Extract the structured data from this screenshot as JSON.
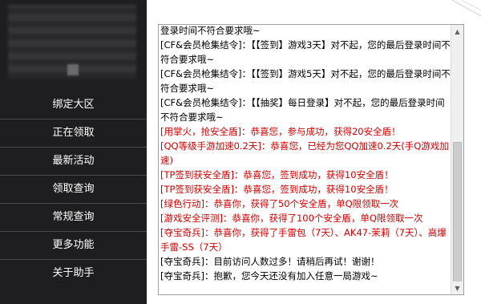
{
  "sidebar": {
    "items": [
      {
        "label": "绑定大区"
      },
      {
        "label": "正在领取"
      },
      {
        "label": "最新活动"
      },
      {
        "label": "领取查询"
      },
      {
        "label": "常规查询"
      },
      {
        "label": "更多功能"
      },
      {
        "label": "关于助手"
      }
    ]
  },
  "log": {
    "lines": [
      {
        "text": "登录时间不符合要求哦~",
        "color": "#000000"
      },
      {
        "text": "[CF&会员枪集结令]：【【签到】游戏3天】对不起，您的最后登录时间不符合要求哦~",
        "color": "#000000"
      },
      {
        "text": "[CF&会员枪集结令]：【【签到】游戏5天】对不起，您的最后登录时间不符合要求哦~",
        "color": "#000000"
      },
      {
        "text": "[CF&会员枪集结令]：【【抽奖】每日登录】对不起，您的最后登录时间不符合要求哦~",
        "color": "#000000"
      },
      {
        "text": "[用掌火，抢安全盾]：恭喜您，参与成功，获得20安全盾！",
        "color": "#d40000"
      },
      {
        "text": "[QQ等级手游加速0.2天]：恭喜您，已经为您QQ加速0.2天(手Q游戏加速)",
        "color": "#d40000"
      },
      {
        "text": "[TP签到获安全盾]：恭喜您，签到成功，获得10安全盾！",
        "color": "#d40000"
      },
      {
        "text": "[TP签到获安全盾]：恭喜您，签到成功，获得10安全盾！",
        "color": "#d40000"
      },
      {
        "text": "[绿色行动]：恭喜你，获得了50个安全盾，单Q限领取一次",
        "color": "#d40000"
      },
      {
        "text": "[游戏安全评测]：恭喜你，获得了100个安全盾，单Q限领取一次",
        "color": "#d40000"
      },
      {
        "text": "[夺宝奇兵]：恭喜你，获得了手雷包（7天）、AK47-茉莉（7天）、高爆手雷-SS（7天）",
        "color": "#d40000"
      },
      {
        "text": "[夺宝奇兵]：目前访问人数过多！请稍后再试！谢谢！",
        "color": "#000000"
      },
      {
        "text": "[夺宝奇兵]：抱歉，您今天还没有加入任意一局游戏~",
        "color": "#000000"
      }
    ]
  },
  "scrollbar": {
    "up_icon": "arrow-up-icon",
    "down_icon": "arrow-down-icon"
  },
  "colors": {
    "sidebar_bg": "#1e1e20",
    "success_text": "#d40000",
    "normal_text": "#000000"
  }
}
